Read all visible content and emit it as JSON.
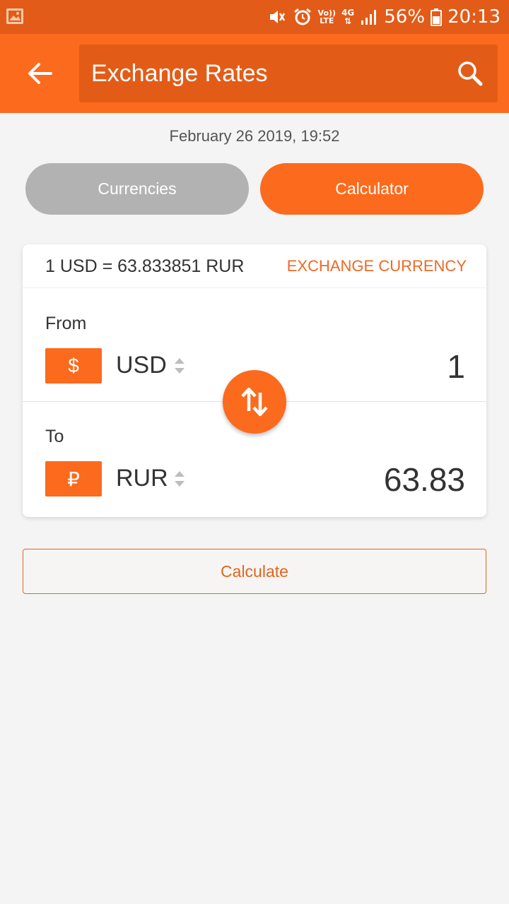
{
  "status_bar": {
    "network_lte_top": "Vo))",
    "network_lte_bottom": "LTE",
    "network_4g": "4G",
    "battery_percent": "56%",
    "time": "20:13"
  },
  "app_bar": {
    "title": "Exchange Rates"
  },
  "date": "February 26 2019, 19:52",
  "tabs": [
    {
      "label": "Currencies",
      "active": false
    },
    {
      "label": "Calculator",
      "active": true
    }
  ],
  "converter": {
    "rate_text": "1 USD = 63.833851 RUR",
    "exchange_link": "EXCHANGE CURRENCY",
    "from": {
      "label": "From",
      "symbol": "$",
      "code": "USD",
      "amount": "1"
    },
    "to": {
      "label": "To",
      "symbol": "₽",
      "code": "RUR",
      "amount": "63.83"
    }
  },
  "calculate_label": "Calculate",
  "colors": {
    "accent": "#fc6a1d",
    "status_bar": "#e25b18",
    "inactive_tab": "#b2b2b2"
  }
}
